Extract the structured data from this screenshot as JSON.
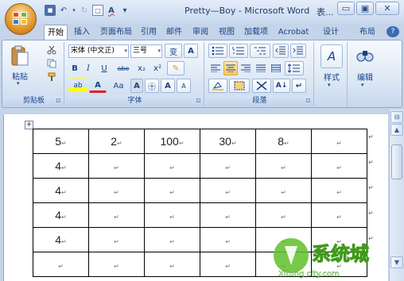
{
  "window": {
    "title": "Pretty—Boy - Microsoft Word",
    "title_extra": "表...",
    "buttons": {
      "minimize": "▭",
      "restore": "▣",
      "close": "✕"
    }
  },
  "qat": {
    "save": "💾",
    "undo": "↶",
    "redo": "↻",
    "print_preview": "🔍",
    "spelling": "A",
    "more": "▾"
  },
  "tabs": [
    "开始",
    "插入",
    "页面布局",
    "引用",
    "邮件",
    "审阅",
    "视图",
    "加载项",
    "Acrobat",
    "设计",
    "布局"
  ],
  "help": "?",
  "ribbon": {
    "clipboard": {
      "label": "剪贴板",
      "paste": "粘贴",
      "launcher": "⊡"
    },
    "font": {
      "label": "字体",
      "font_name": "宋体 (中文正)",
      "font_size": "三号",
      "bold": "B",
      "italic": "I",
      "underline": "U",
      "strike": "abe",
      "subscript": "x₂",
      "superscript": "x²",
      "grow": "A",
      "shrink": "A",
      "case": "Aa",
      "border_a": "A",
      "enclosed": "㊉",
      "phonetic": "变",
      "char_border": "A",
      "font_color": "A",
      "highlight": "ab",
      "launcher": "⊡"
    },
    "paragraph": {
      "label": "段落",
      "launcher": "⊡"
    },
    "styles": {
      "label": "样式",
      "icon": "A"
    },
    "editing": {
      "label": "编辑",
      "icon": "A"
    }
  },
  "table": {
    "rows": [
      [
        "5",
        "2",
        "100",
        "30",
        "8",
        ""
      ],
      [
        "4",
        "",
        "",
        "",
        "",
        ""
      ],
      [
        "4",
        "",
        "",
        "",
        "",
        ""
      ],
      [
        "4",
        "",
        "",
        "",
        "",
        ""
      ],
      [
        "4",
        "",
        "",
        "",
        "",
        ""
      ],
      [
        "",
        "",
        "",
        "",
        "",
        ""
      ]
    ],
    "cell_mark": "↵",
    "handle": "+"
  },
  "watermark": {
    "brand": "系统城",
    "url": "Xitong city.com"
  }
}
